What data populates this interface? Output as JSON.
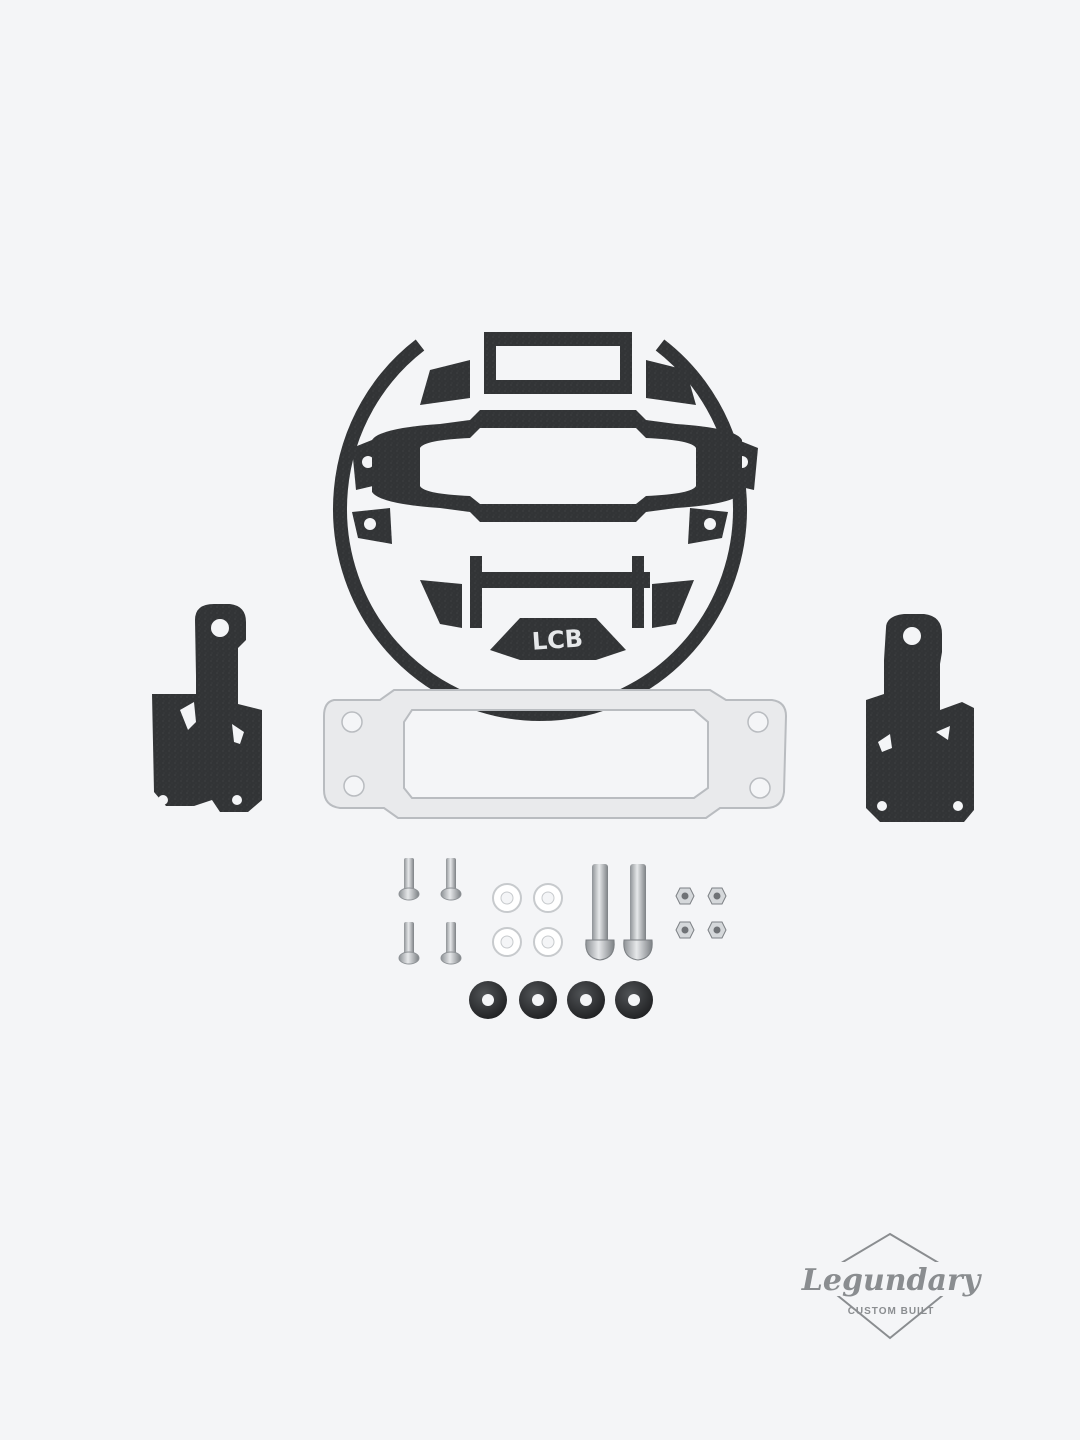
{
  "colors": {
    "background": "#f4f5f7",
    "metal_black": "#2f3133",
    "metal_black_highlight": "#5a5d60",
    "plate_silver": "#e9eaec",
    "plate_border": "#b9bcc0",
    "steel": "#c7cacd",
    "rubber": "#2c2d2f",
    "washer": "#ffffff",
    "logo_gray": "#8a8d90"
  },
  "items": {
    "grille": {
      "icon": "grille-cover-icon",
      "emblem_text": "LCB"
    },
    "brackets": {
      "icon": "mounting-bracket-icon",
      "count": 2
    },
    "plate": {
      "icon": "adapter-plate-icon"
    },
    "short_bolts": {
      "icon": "short-bolt-icon",
      "count": 4
    },
    "washers": {
      "icon": "nylon-washer-icon",
      "count": 4
    },
    "long_bolts": {
      "icon": "long-bolt-icon",
      "count": 2
    },
    "nuts": {
      "icon": "hex-nut-icon",
      "count": 4
    },
    "grommets": {
      "icon": "rubber-grommet-icon",
      "count": 4
    }
  },
  "logo": {
    "brand": "Legundary",
    "tagline": "CUSTOM BUILT"
  }
}
